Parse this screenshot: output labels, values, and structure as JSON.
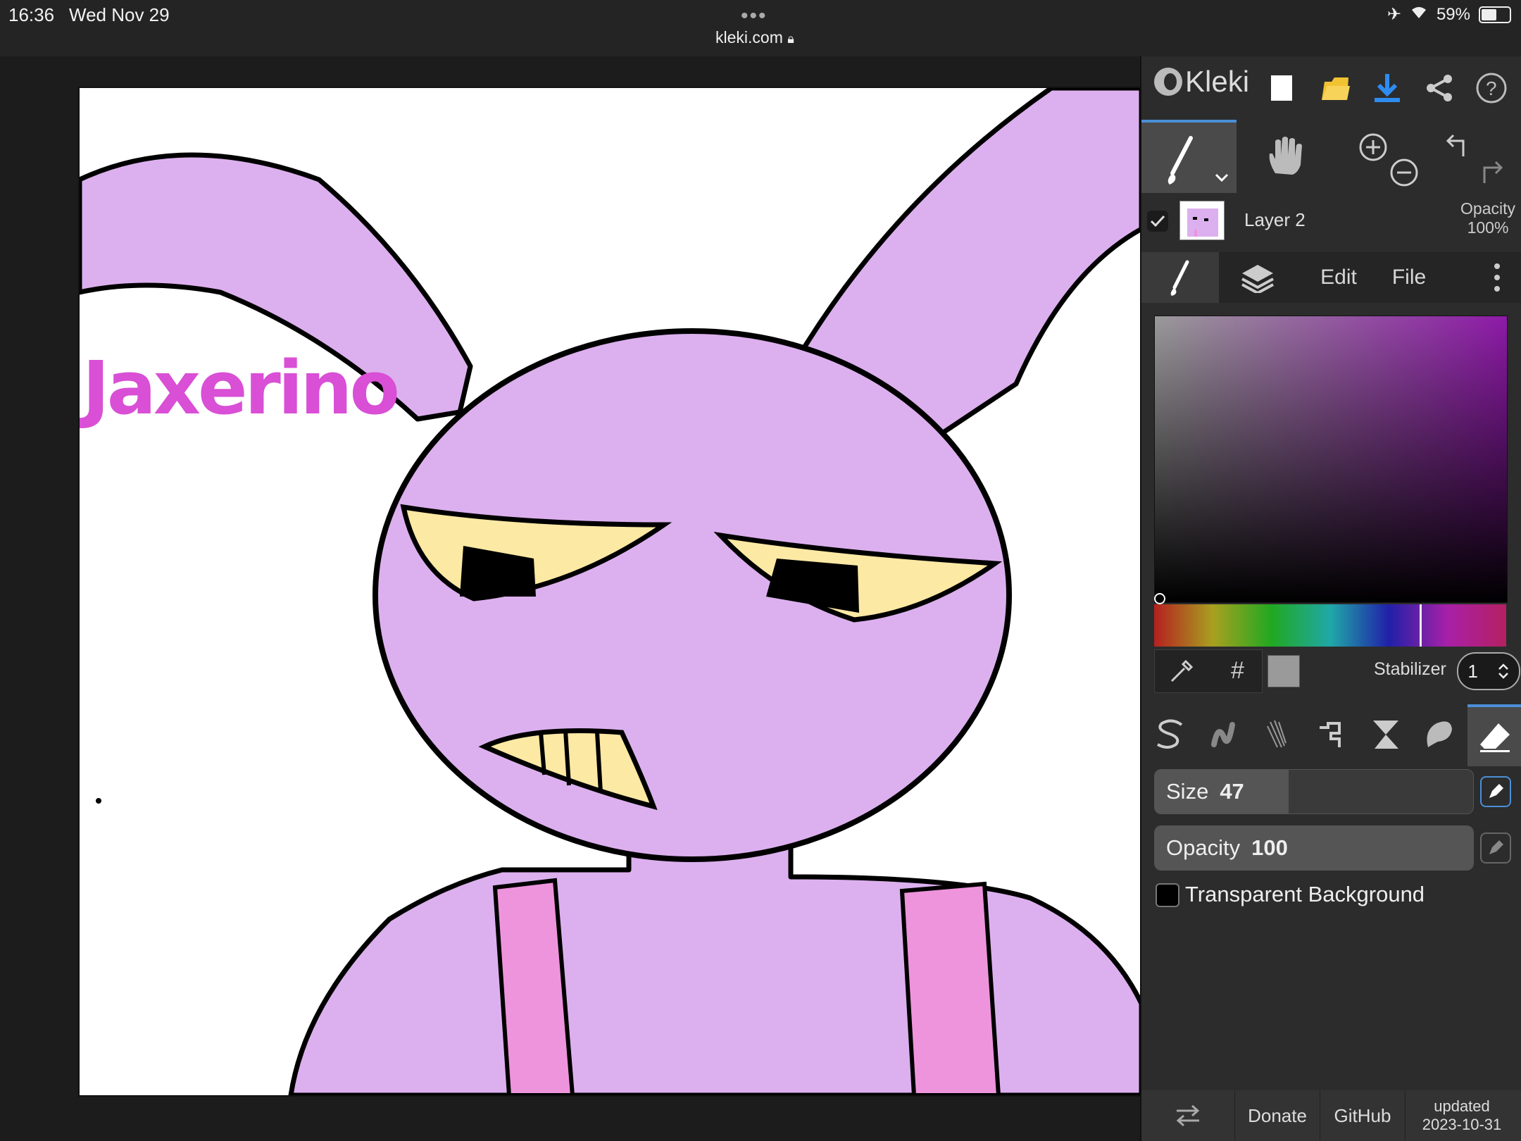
{
  "status_bar": {
    "time": "16:36",
    "date": "Wed Nov 29",
    "url": "kleki.com",
    "battery": "59%",
    "battery_level": 0.59
  },
  "canvas": {
    "drawing_text": "Jaxerino"
  },
  "panel": {
    "app_name": "Kleki",
    "layer": {
      "name": "Layer 2",
      "opacity_label": "Opacity",
      "opacity_value": "100%"
    },
    "tabs": [
      "Edit",
      "File"
    ],
    "stabilizer_label": "Stabilizer",
    "stabilizer_value": "1",
    "hex_symbol": "#",
    "size_label": "Size",
    "size_value": "47",
    "size_fraction": 0.42,
    "opacity_label": "Opacity",
    "opacity_value": "100",
    "opacity_fraction": 1.0,
    "transparent_bg_label": "Transparent Background",
    "footer": {
      "donate": "Donate",
      "github": "GitHub",
      "updated_label": "updated",
      "updated_date": "2023-10-31"
    }
  },
  "colors": {
    "accent": "#4b8fd6",
    "character_fill": "#dcb0ee",
    "eye_fill": "#fce9a4",
    "suspender": "#ee94dd",
    "text_magenta": "#d94fd6",
    "selected_color": "#9a9a9a"
  },
  "icons": [
    "new-image-icon",
    "open-folder-icon",
    "download-icon",
    "share-icon",
    "help-icon",
    "brush-icon",
    "hand-icon",
    "zoom-in-icon",
    "zoom-out-icon",
    "undo-icon",
    "redo-icon",
    "layers-icon",
    "more-icon",
    "eyedropper-icon",
    "eraser-icon",
    "pen-pressure-icon",
    "swap-icon"
  ]
}
